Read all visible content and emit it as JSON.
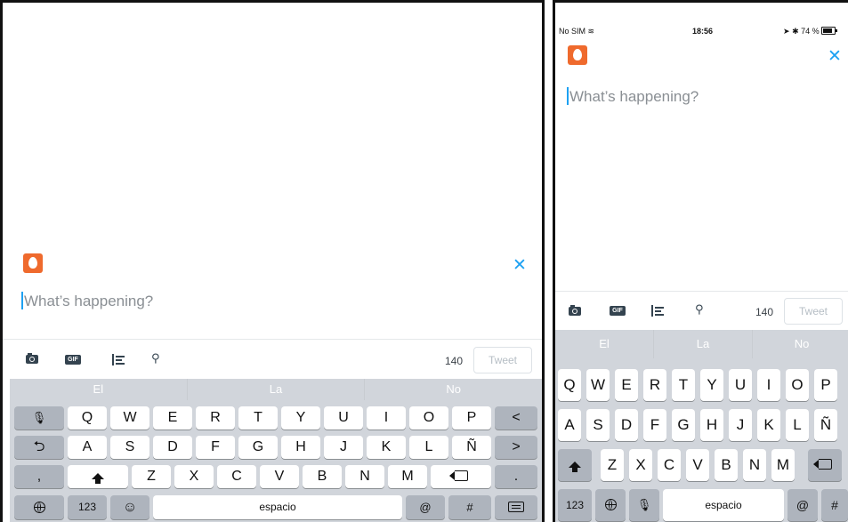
{
  "compose": {
    "placeholder": "What’s happening?",
    "char_count": "140",
    "tweet_label": "Tweet"
  },
  "icons": {
    "avatar": "default-egg-avatar-icon",
    "close": "close-icon",
    "toolbar": [
      "camera-icon",
      "gif-icon",
      "poll-icon",
      "location-icon"
    ]
  },
  "colors": {
    "accent": "#1da1f2",
    "avatar_bg": "#ef6a2d",
    "keyboard_bg": "#d1d5db",
    "key_special": "#aeb4bd"
  },
  "suggestions": [
    "El",
    "La",
    "No"
  ],
  "gif_label": "GIF",
  "symbols": {
    "close": "✕",
    "pin": "⚲",
    "left": "<",
    "right": ">",
    "mic": "🎙",
    "return": "⮌",
    "emoji": "☺",
    "comma": ",",
    "period": ".",
    "at": "@",
    "hash": "#"
  },
  "keyboard": {
    "row1": [
      "Q",
      "W",
      "E",
      "R",
      "T",
      "Y",
      "U",
      "I",
      "O",
      "P"
    ],
    "row2": [
      "A",
      "S",
      "D",
      "F",
      "G",
      "H",
      "J",
      "K",
      "L",
      "Ñ"
    ],
    "row3": [
      "Z",
      "X",
      "C",
      "V",
      "B",
      "N",
      "M"
    ],
    "numbers_label": "123",
    "space_label": "espacio"
  },
  "status_bar": {
    "carrier": "No SIM",
    "wifi": "≋",
    "time": "18:56",
    "location": "➤",
    "bluetooth": "✱",
    "battery": "74 %"
  }
}
